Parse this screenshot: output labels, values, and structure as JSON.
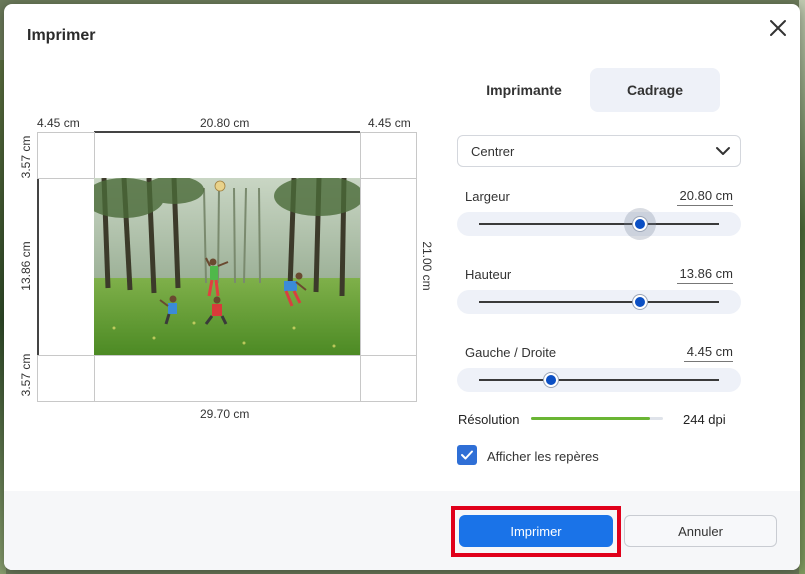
{
  "dialog": {
    "title": "Imprimer",
    "close_icon": "close-icon"
  },
  "preview": {
    "margin_left": "4.45 cm",
    "image_width": "20.80 cm",
    "margin_right": "4.45 cm",
    "margin_top": "3.57 cm",
    "image_height": "13.86 cm",
    "margin_bottom": "3.57 cm",
    "paper_height": "21.00 cm",
    "paper_width": "29.70 cm"
  },
  "tabs": [
    {
      "label": "Imprimante",
      "selected": false
    },
    {
      "label": "Cadrage",
      "selected": true
    }
  ],
  "position_select": {
    "value": "Centrer",
    "icon": "chevron-down-icon"
  },
  "sliders": [
    {
      "label": "Largeur",
      "value": "20.80 cm",
      "fraction": 0.67
    },
    {
      "label": "Hauteur",
      "value": "13.86 cm",
      "fraction": 0.67
    },
    {
      "label": "Gauche / Droite",
      "value": "4.45 cm",
      "fraction": 0.3
    }
  ],
  "resolution": {
    "label": "Résolution",
    "value": "244 dpi",
    "fraction": 0.9,
    "color": "#6ab534"
  },
  "show_guides": {
    "label": "Afficher les repères",
    "checked": true,
    "icon": "checkmark-icon"
  },
  "buttons": {
    "print": "Imprimer",
    "cancel": "Annuler"
  },
  "colors": {
    "accent": "#1a73e8",
    "highlight": "#e0001b"
  }
}
